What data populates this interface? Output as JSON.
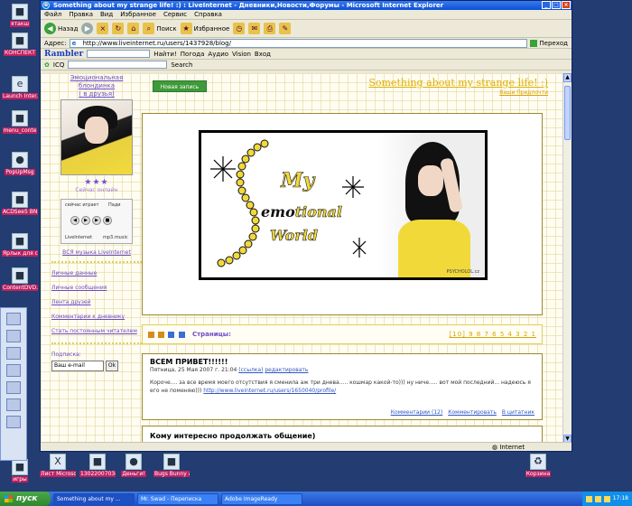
{
  "desktop": {
    "icons": [
      {
        "label": "ятакш",
        "glyph": "■"
      },
      {
        "label": "КОНСПЕКТ",
        "glyph": "■"
      },
      {
        "label": "Launch Inter...",
        "glyph": "e"
      },
      {
        "label": "menu_conte",
        "glyph": "■"
      },
      {
        "label": "PopUpMsg",
        "glyph": "●"
      },
      {
        "label": "ACDSee5 BNP Image",
        "glyph": "■"
      },
      {
        "label": "Ярлык для chk.co",
        "glyph": "■"
      },
      {
        "label": "ContentDVD...",
        "glyph": "■"
      },
      {
        "label": "игры",
        "glyph": "■"
      },
      {
        "label": "Лист Microsoft Excel",
        "glyph": "X"
      },
      {
        "label": "13022007034",
        "glyph": "■"
      },
      {
        "label": "Деньги!",
        "glyph": "●"
      },
      {
        "label": "Bugs Bunny and Taz",
        "glyph": "■"
      },
      {
        "label": "Корзина",
        "glyph": "♻"
      }
    ]
  },
  "window": {
    "title": "Something about my strange life! :) : LiveInternet - Дневники,Новости,Форумы - Microsoft Internet Explorer",
    "menu": [
      "Файл",
      "Правка",
      "Вид",
      "Избранное",
      "Сервис",
      "Справка"
    ],
    "toolbar": {
      "back": "Назад",
      "search": "Поиск",
      "favorites": "Избранное"
    },
    "address_label": "Адрес:",
    "address_value": "http://www.liveinternet.ru/users/1437928/blog/",
    "go_label": "Переход",
    "rambler": {
      "logo": "Rambler",
      "find": "Найти!",
      "weather": "Погода",
      "audio": "Аудио",
      "vision": "Vision",
      "login": "Вход"
    },
    "icq": {
      "label": "ICQ",
      "search": "Search"
    },
    "status": "Internet"
  },
  "page": {
    "user_top_link": "Эмоциональная блондинка",
    "user_friends_link": "( в друзья)",
    "stars": "★★★",
    "online_status": "Сейчас онлайн",
    "player": {
      "now": "сейчас играет",
      "pad": "Пади",
      "brand": "LiveInternet",
      "site": "mp3.music"
    },
    "music_link": "ВСЯ музыка LiveInternet",
    "side_links": [
      "Личные данные",
      "Личные сообщения",
      "Лента друзей",
      "Комментарии к дневнику",
      "Стать постоянным читателем"
    ],
    "subscribe_label": "Подписка:",
    "subscribe_placeholder": "Ваш e-mail",
    "subscribe_button": "Ok",
    "new_post_button": "Новая запись",
    "blog_title": "Something about my strange life! :)",
    "blog_subtitle": "Ваши Предпочти",
    "banner": {
      "my": "My",
      "emo_pre": "",
      "emo": "emo",
      "emo_post": "tional",
      "world": "World",
      "credit": "PSYCHOLOL.cz"
    },
    "pages_label": "Страницы:",
    "pages": "[10] 9 8 7 6 5 4 3 2 1",
    "post": {
      "title": "ВСЕМ ПРИВЕТ!!!!!!",
      "meta": "Пятница, 25 Мая 2007 г. 21:04",
      "meta_link1": "(ссылка)",
      "meta_link2": "редактировать",
      "body": "Короче.... за все время моего отсутствия я сменила аж три днева..... кошмар какой-то))) ну ниче..... вот мой последний... надеюсь я его не поменяю)))",
      "body_link": "http://www.liveinternet.ru/users/1650040/profile/",
      "comments": "Комментарии (12)",
      "comment": "Комментировать",
      "quote": "В цитатник"
    },
    "post2_title": "Кому интересно продолжать общение)"
  },
  "taskbar": {
    "start": "пуск",
    "tasks": [
      "Something about my ...",
      "Mr. Swad - Переписка",
      "Adobe ImageReady"
    ],
    "clock": "17:18"
  },
  "colors": {
    "accent_yellow": "#f2d93a",
    "link_purple": "#6a4bc8",
    "taskbar_blue": "#1e4fc3"
  }
}
